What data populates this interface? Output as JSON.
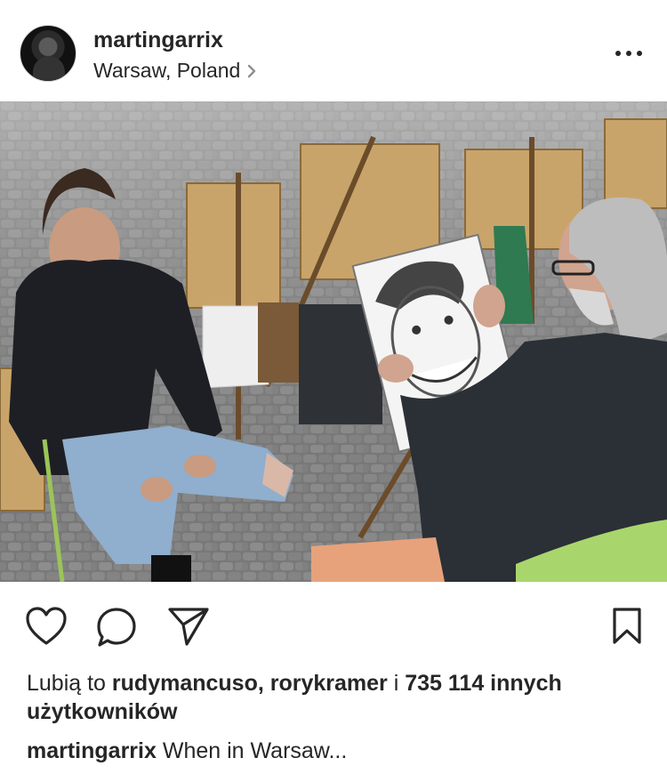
{
  "post": {
    "username": "martingarrix",
    "location": "Warsaw, Poland"
  },
  "icons": {
    "more": "more-options-icon",
    "like": "heart-icon",
    "comment": "comment-icon",
    "share": "share-icon",
    "save": "bookmark-icon",
    "location_chevron": "chevron-right-icon"
  },
  "likes": {
    "prefix": "Lubią to",
    "user1": "rudymancuso,",
    "user2": "rorykramer",
    "connector": "i",
    "others": "735 114 innych użytkowników"
  },
  "caption": {
    "username": "martingarrix",
    "text": "When in Warsaw..."
  }
}
